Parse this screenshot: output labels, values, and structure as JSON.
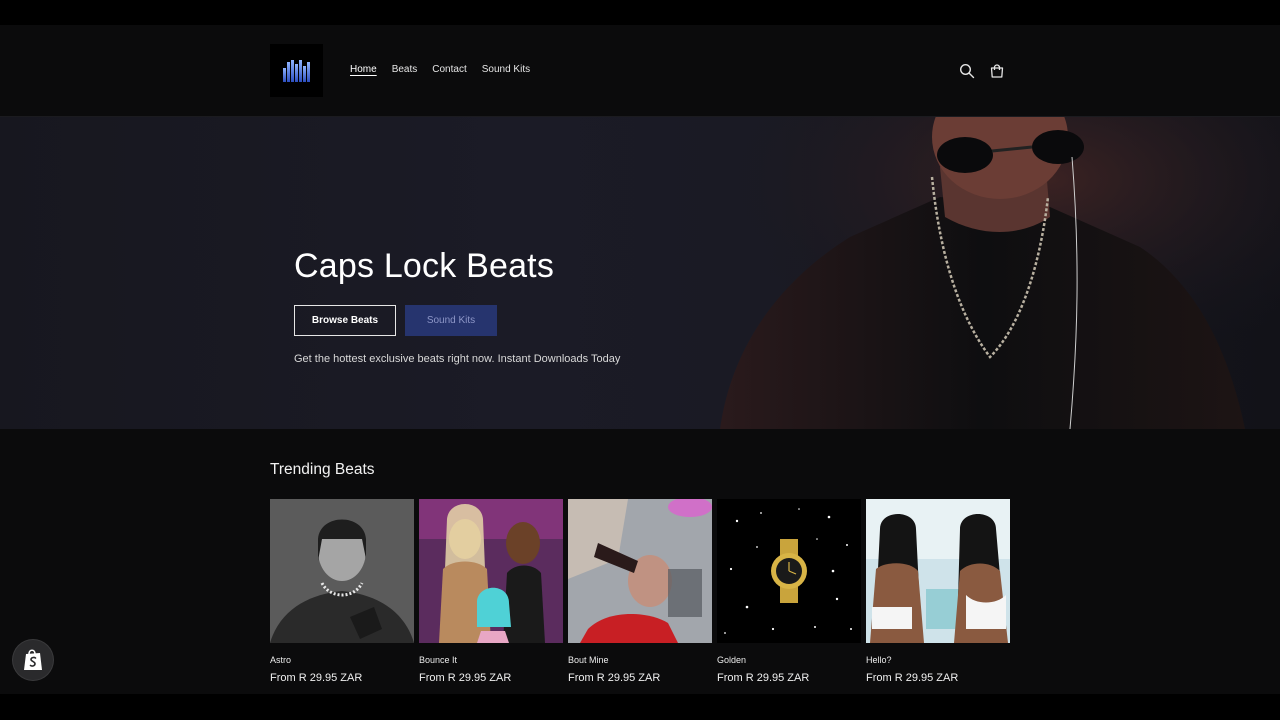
{
  "nav": {
    "items": [
      {
        "label": "Home",
        "active": true
      },
      {
        "label": "Beats",
        "active": false
      },
      {
        "label": "Contact",
        "active": false
      },
      {
        "label": "Sound Kits",
        "active": false
      }
    ]
  },
  "header_icons": [
    "search-icon",
    "cart-icon"
  ],
  "hero": {
    "title": "Caps Lock Beats",
    "browse_label": "Browse Beats",
    "kits_label": "Sound Kits",
    "subtitle": "Get the hottest exclusive beats right now. Instant Downloads Today"
  },
  "trending": {
    "title": "Trending Beats",
    "products": [
      {
        "name": "Astro",
        "price": "From R 29.95 ZAR"
      },
      {
        "name": "Bounce It",
        "price": "From R 29.95 ZAR"
      },
      {
        "name": "Bout Mine",
        "price": "From R 29.95 ZAR"
      },
      {
        "name": "Golden",
        "price": "From R 29.95 ZAR"
      },
      {
        "name": "Hello?",
        "price": "From R 29.95 ZAR"
      }
    ]
  },
  "colors": {
    "accent": "#26346e",
    "background": "#0b0b0c",
    "text": "#ffffff"
  }
}
